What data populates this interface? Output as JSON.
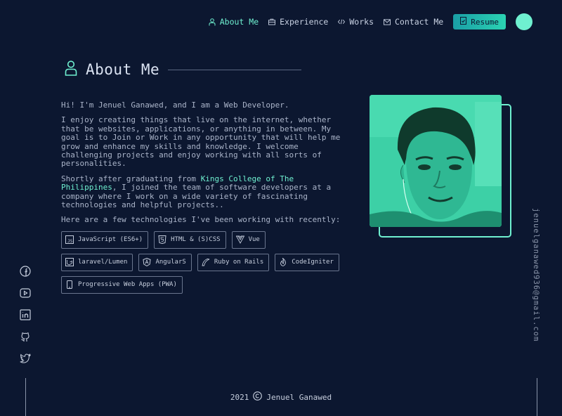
{
  "nav": {
    "items": [
      {
        "label": "About Me",
        "icon": "user-icon",
        "active": true
      },
      {
        "label": "Experience",
        "icon": "briefcase-icon",
        "active": false
      },
      {
        "label": "Works",
        "icon": "code-icon",
        "active": false
      },
      {
        "label": "Contact Me",
        "icon": "mail-icon",
        "active": false
      }
    ],
    "resume_label": "Resume"
  },
  "section": {
    "title": "About Me"
  },
  "about": {
    "intro": "Hi! I'm Jenuel Ganawed, and I am a Web Developer.",
    "p2": "I enjoy creating things that live on the internet, whether that be websites, applications, or anything in between. My goal is to Join or Work in any opportunity that will help me grow and enhance my skills and knowledge. I welcome challenging projects and enjoy working with all sorts of personalities.",
    "p3_before": "Shortly after graduating from ",
    "p3_link": "Kings College of The Philippines",
    "p3_after": ", I joined the team of software developers at a company where I work on a wide variety of fascinating technologies and helpful projects..",
    "p4": "Here are a few technologies I've been working with recently:"
  },
  "technologies": [
    {
      "label": "JavaScript (ES6+)",
      "icon": "javascript-icon"
    },
    {
      "label": "HTML & (S)CSS",
      "icon": "html5-icon"
    },
    {
      "label": "Vue",
      "icon": "vue-icon"
    },
    {
      "label": "laravel/Lumen",
      "icon": "laravel-icon"
    },
    {
      "label": "AngularS",
      "icon": "angular-icon"
    },
    {
      "label": "Ruby on Rails",
      "icon": "rails-icon"
    },
    {
      "label": "CodeIgniter",
      "icon": "codeigniter-icon"
    },
    {
      "label": "Progressive Web Apps (PWA)",
      "icon": "pwa-icon"
    }
  ],
  "social": [
    "facebook-icon",
    "youtube-icon",
    "linkedin-icon",
    "github-icon",
    "twitter-icon"
  ],
  "email": "jenuelganawed936@gmail.com",
  "footer": {
    "year": "2021",
    "name": "Jenuel Ganawed"
  },
  "colors": {
    "background": "#0c1730",
    "accent": "#6ff0d0"
  }
}
